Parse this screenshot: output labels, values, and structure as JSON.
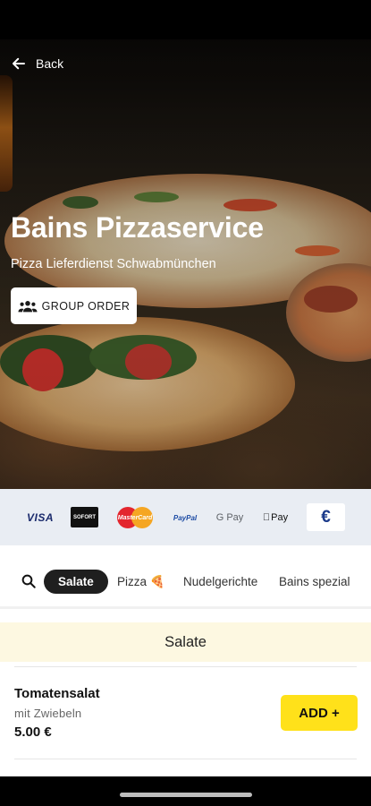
{
  "header": {
    "back_label": "Back"
  },
  "restaurant": {
    "name": "Bains Pizzaservice",
    "subtitle": "Pizza Lieferdienst Schwabmünchen",
    "group_order_label": "GROUP ORDER"
  },
  "payments": [
    {
      "name": "visa",
      "label": "VISA"
    },
    {
      "name": "sofort",
      "label": "SOFORT"
    },
    {
      "name": "mastercard",
      "label": "MasterCard"
    },
    {
      "name": "paypal",
      "label": "PayPal"
    },
    {
      "name": "google-pay",
      "label": "G Pay"
    },
    {
      "name": "apple-pay",
      "label": "Pay"
    },
    {
      "name": "euro-cash",
      "label": "€"
    }
  ],
  "categories": [
    {
      "label": "Salate",
      "active": true
    },
    {
      "label": "Pizza 🍕",
      "active": false
    },
    {
      "label": "Nudelgerichte",
      "active": false
    },
    {
      "label": "Bains spezial",
      "active": false
    }
  ],
  "section": {
    "title": "Salate"
  },
  "items": [
    {
      "name": "Tomatensalat",
      "description": "mit Zwiebeln",
      "price": "5.00 €",
      "add_label": "ADD +"
    }
  ],
  "colors": {
    "accent_yellow": "#ffe11a",
    "section_bg": "#fdf8e1",
    "payments_bg": "#e9edf3",
    "active_category_bg": "#1f1f1f"
  }
}
